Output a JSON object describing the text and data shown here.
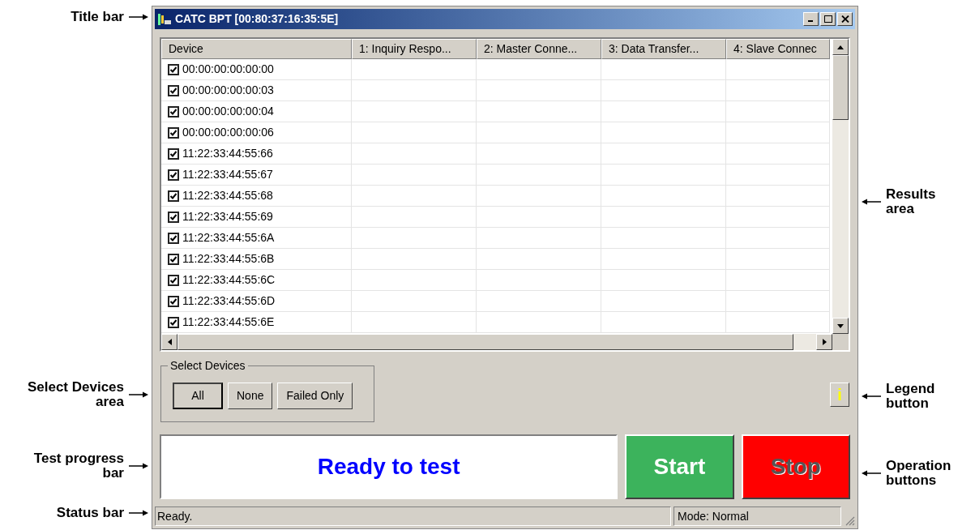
{
  "callouts_left": [
    {
      "label": "Title bar"
    },
    {
      "label": "Select Devices area"
    },
    {
      "label": "Test progress bar"
    },
    {
      "label": "Status bar"
    }
  ],
  "callouts_right": [
    {
      "label": "Results area"
    },
    {
      "label": "Legend button"
    },
    {
      "label": "Operation buttons"
    }
  ],
  "window": {
    "title": "CATC BPT [00:80:37:16:35:5E]"
  },
  "table": {
    "columns": [
      "Device",
      "1: Inquiry Respo...",
      "2: Master Conne...",
      "3: Data Transfer...",
      "4: Slave Connec"
    ],
    "rows": [
      {
        "device": "00:00:00:00:00:00",
        "checked": true
      },
      {
        "device": "00:00:00:00:00:03",
        "checked": true
      },
      {
        "device": "00:00:00:00:00:04",
        "checked": true
      },
      {
        "device": "00:00:00:00:00:06",
        "checked": true
      },
      {
        "device": "11:22:33:44:55:66",
        "checked": true
      },
      {
        "device": "11:22:33:44:55:67",
        "checked": true
      },
      {
        "device": "11:22:33:44:55:68",
        "checked": true
      },
      {
        "device": "11:22:33:44:55:69",
        "checked": true
      },
      {
        "device": "11:22:33:44:55:6A",
        "checked": true
      },
      {
        "device": "11:22:33:44:55:6B",
        "checked": true
      },
      {
        "device": "11:22:33:44:55:6C",
        "checked": true
      },
      {
        "device": "11:22:33:44:55:6D",
        "checked": true
      },
      {
        "device": "11:22:33:44:55:6E",
        "checked": true
      }
    ]
  },
  "select_devices": {
    "title": "Select Devices",
    "buttons": [
      {
        "label": "All",
        "default": true
      },
      {
        "label": "None",
        "default": false
      },
      {
        "label": "Failed Only",
        "default": false
      }
    ]
  },
  "legend_button": {
    "label": "i"
  },
  "progress": {
    "text": "Ready to test"
  },
  "operation_buttons": [
    {
      "label": "Start",
      "kind": "start",
      "disabled": false
    },
    {
      "label": "Stop",
      "kind": "stop",
      "disabled": true
    }
  ],
  "status_bar": {
    "message": "Ready.",
    "mode": "Mode: Normal"
  }
}
